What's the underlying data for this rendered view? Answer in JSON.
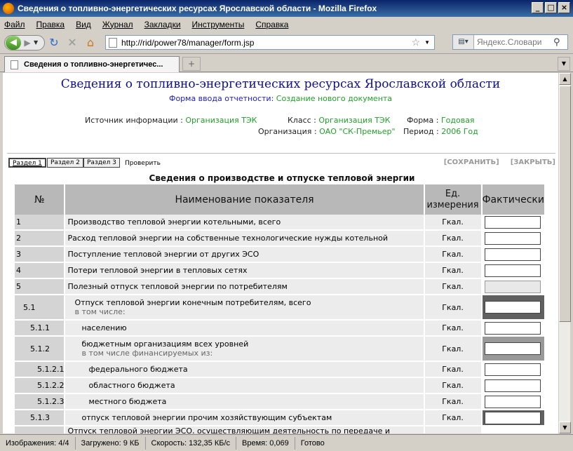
{
  "window": {
    "title": "Сведения о топливно-энергетических ресурсах Ярославской области - Mozilla Firefox"
  },
  "menu": [
    "Файл",
    "Правка",
    "Вид",
    "Журнал",
    "Закладки",
    "Инструменты",
    "Справка"
  ],
  "nav": {
    "url": "http://rid/power78/manager/form.jsp",
    "search_placeholder": "Яндекс.Словари"
  },
  "tab": {
    "label": "Сведения о топливно-энергетичес..."
  },
  "page": {
    "title": "Сведения о топливно-энергетических ресурсах Ярославской области",
    "form_label": "Форма ввода отчетности:",
    "form_value": "Создание нового документа",
    "source_label": "Источник информации :",
    "source_value": "Организация ТЭК",
    "class_label": "Класс :",
    "class_value": "Организация ТЭК",
    "form_type_label": "Форма :",
    "form_type_value": "Годовая",
    "org_label": "Организация :",
    "org_value": "ОАО \"СК-Премьер\"",
    "period_label": "Период :",
    "period_value": "2006 Год"
  },
  "sections": [
    "Раздел 1",
    "Раздел 2",
    "Раздел 3"
  ],
  "check_label": "Проверить",
  "save_label": "[СОХРАНИТЬ]",
  "close_label": "[ЗАКРЫТЬ]",
  "table": {
    "title": "Сведения о производстве и отпуске тепловой энергии",
    "headers": [
      "№",
      "Наименование показателя",
      "Ед. измерения",
      "Фактически"
    ],
    "rows": [
      {
        "num": "1",
        "name": "Производство тепловой энергии котельными, всего",
        "unit": "Гкал."
      },
      {
        "num": "2",
        "name": "Расход тепловой энергии на собственные технологические нужды котельной",
        "unit": "Гкал."
      },
      {
        "num": "3",
        "name": "Поступление тепловой энергии от других ЭСО",
        "unit": "Гкал."
      },
      {
        "num": "4",
        "name": "Потери тепловой энергии в тепловых сетях",
        "unit": "Гкал."
      },
      {
        "num": "5",
        "name": "Полезный отпуск тепловой энергии по потребителям",
        "unit": "Гкал."
      },
      {
        "num": "5.1",
        "name": "Отпуск тепловой энергии конечным потребителям, всего",
        "sub": "в том числе:",
        "unit": "Гкал."
      },
      {
        "num": "5.1.1",
        "name": "населению",
        "unit": "Гкал."
      },
      {
        "num": "5.1.2",
        "name": "бюджетным организациям всех уровней",
        "sub": "в том числе финансируемых из:",
        "unit": "Гкал."
      },
      {
        "num": "5.1.2.1",
        "name": "федерального бюджета",
        "unit": "Гкал."
      },
      {
        "num": "5.1.2.2",
        "name": "областного бюджета",
        "unit": "Гкал."
      },
      {
        "num": "5.1.2.3",
        "name": "местного бюджета",
        "unit": "Гкал."
      },
      {
        "num": "5.1.3",
        "name": "отпуск тепловой энергии прочим хозяйствующим субъектам",
        "unit": "Гкал."
      },
      {
        "num": "",
        "name": "Отпуск тепловой энергии ЭСО, осуществляющим деятельность по передаче и",
        "unit": ""
      }
    ]
  },
  "status": {
    "images": "Изображения: 4/4",
    "loaded": "Загружено: 9 КБ",
    "speed": "Скорость: 132,35 КБ/с",
    "time": "Время: 0,069",
    "state": "Готово"
  }
}
